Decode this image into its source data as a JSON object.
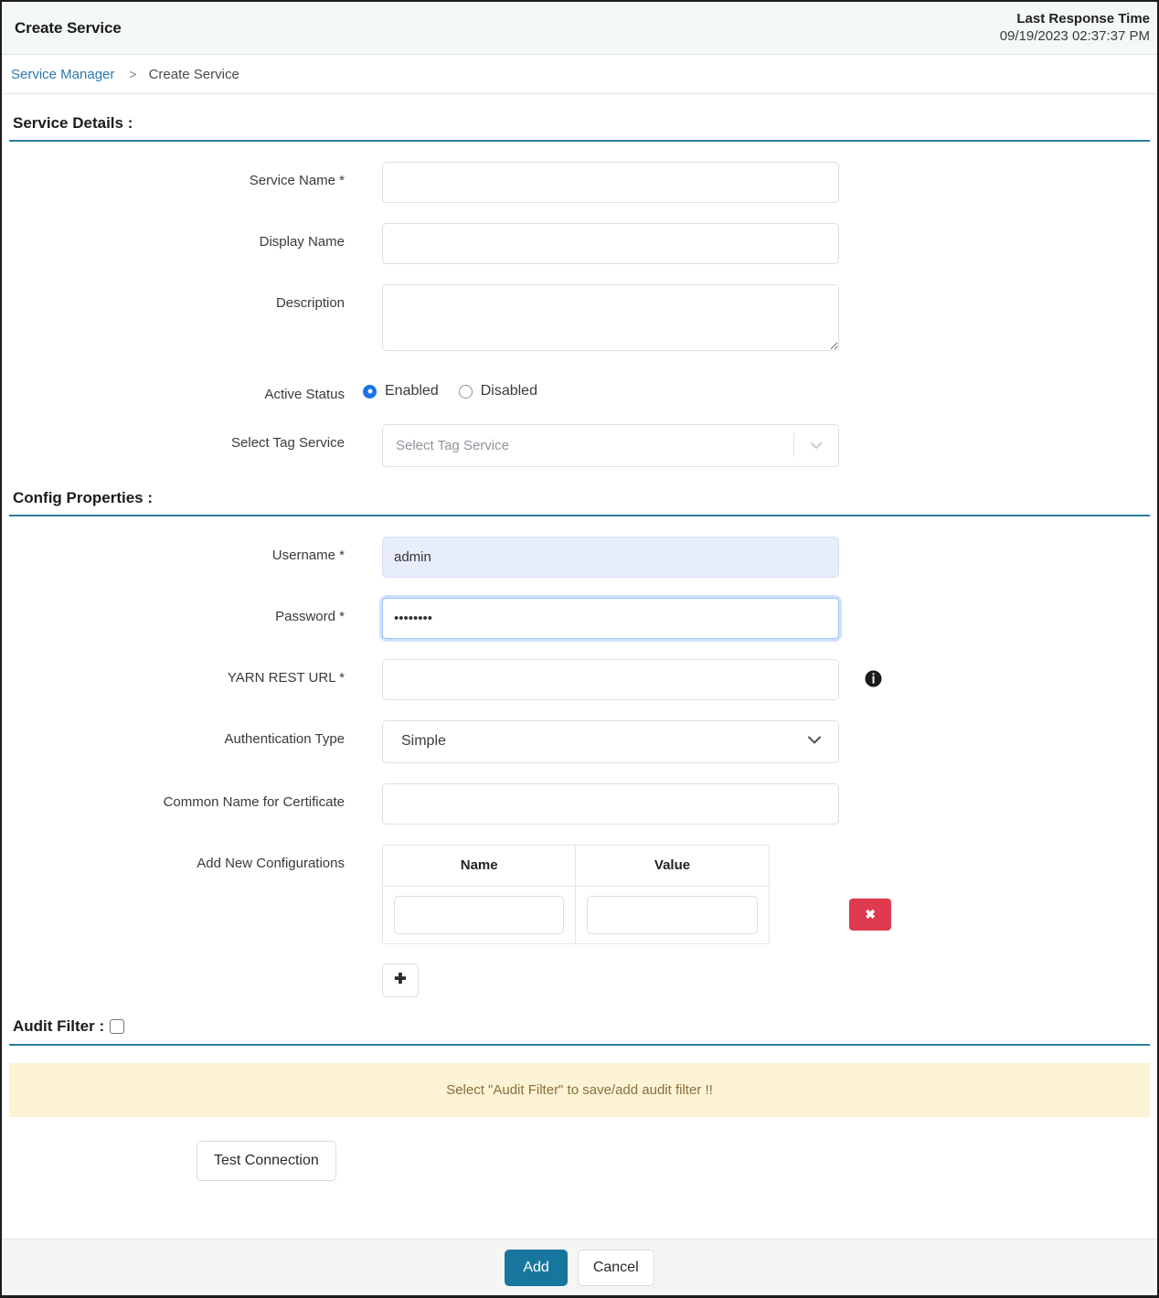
{
  "header": {
    "title": "Create Service",
    "last_response_label": "Last Response Time",
    "last_response_value": "09/19/2023 02:37:37 PM"
  },
  "breadcrumb": {
    "root": "Service Manager",
    "separator": ">",
    "current": "Create Service"
  },
  "service_details": {
    "section_title": "Service Details :",
    "service_name": {
      "label": "Service Name *",
      "value": "",
      "placeholder": ""
    },
    "display_name": {
      "label": "Display Name",
      "value": "",
      "placeholder": ""
    },
    "description": {
      "label": "Description",
      "value": "",
      "placeholder": ""
    },
    "active_status": {
      "label": "Active Status",
      "options": [
        "Enabled",
        "Disabled"
      ],
      "enabled_label": "Enabled",
      "disabled_label": "Disabled",
      "selected": "Enabled"
    },
    "tag_service": {
      "label": "Select Tag Service",
      "placeholder": "Select Tag Service",
      "value": ""
    }
  },
  "config_properties": {
    "section_title": "Config Properties :",
    "username": {
      "label": "Username *",
      "value": "admin"
    },
    "password": {
      "label": "Password *",
      "value": "••••••••"
    },
    "yarn_rest_url": {
      "label": "YARN REST URL *",
      "value": "",
      "info_icon": "info-icon"
    },
    "auth_type": {
      "label": "Authentication Type",
      "value": "Simple"
    },
    "common_name": {
      "label": "Common Name for Certificate",
      "value": ""
    },
    "add_new_configurations": {
      "label": "Add New Configurations",
      "columns": [
        "Name",
        "Value"
      ],
      "rows": [
        {
          "name": "",
          "value": "",
          "delete_label": "✖"
        }
      ],
      "add_row_label": "✚"
    }
  },
  "audit_filter": {
    "label": "Audit Filter :",
    "checked": false,
    "alert_message": "Select \"Audit Filter\" to save/add audit filter !!"
  },
  "actions": {
    "test_connection": "Test Connection",
    "add": "Add",
    "cancel": "Cancel"
  },
  "colors": {
    "accent": "#17769e",
    "section_rule": "#2a7f9e",
    "link": "#2a7ab0",
    "danger": "#e03a4e",
    "alert_bg": "#fcf3d4",
    "alert_text": "#8a6d3b",
    "autofill_bg": "#e8edfb",
    "radio_selected": "#1a73e8"
  }
}
